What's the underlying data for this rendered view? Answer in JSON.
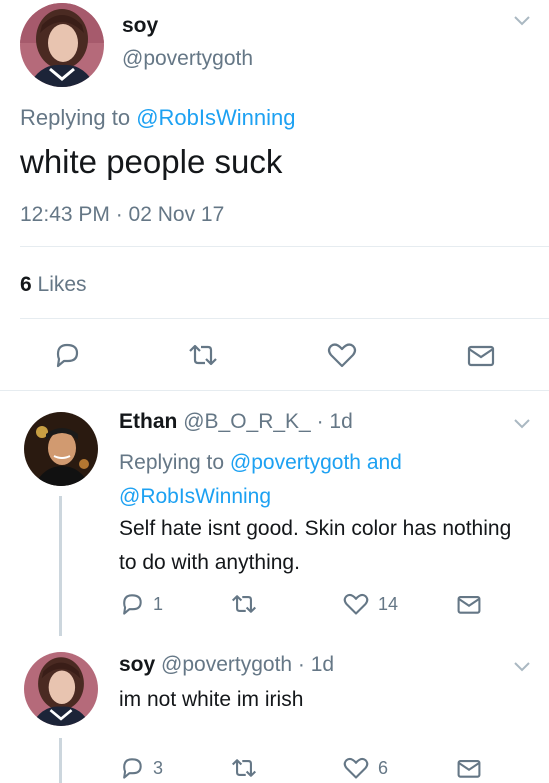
{
  "main_tweet": {
    "display_name": "soy",
    "handle": "@povertygoth",
    "replying_prefix": "Replying to",
    "replying_to": "@RobIsWinning",
    "text": "white people suck",
    "timestamp": "12:43 PM · 02 Nov 17",
    "likes_count": "6",
    "likes_label": "Likes"
  },
  "reply_1": {
    "display_name": "Ethan",
    "handle_time": "@B_O_R_K_ · 1d",
    "replying_prefix": "Replying to",
    "replying_to_1": "@povertygoth",
    "replying_and": "and",
    "replying_to_2": "@RobIsWinning",
    "text": "Self hate isnt good. Skin color has nothing to do with anything.",
    "reply_count": "1",
    "like_count": "14"
  },
  "reply_2": {
    "display_name": "soy",
    "handle_time": "@povertygoth · 1d",
    "text": "im not white im irish",
    "reply_count": "3",
    "like_count": "6"
  },
  "colors": {
    "accent": "#1da1f2",
    "secondary_text": "#657786",
    "primary_text": "#14171a",
    "divider": "#e6ecf0"
  },
  "icons": [
    "reply-icon",
    "retweet-icon",
    "like-icon",
    "direct-message-icon",
    "chevron-down-icon"
  ]
}
